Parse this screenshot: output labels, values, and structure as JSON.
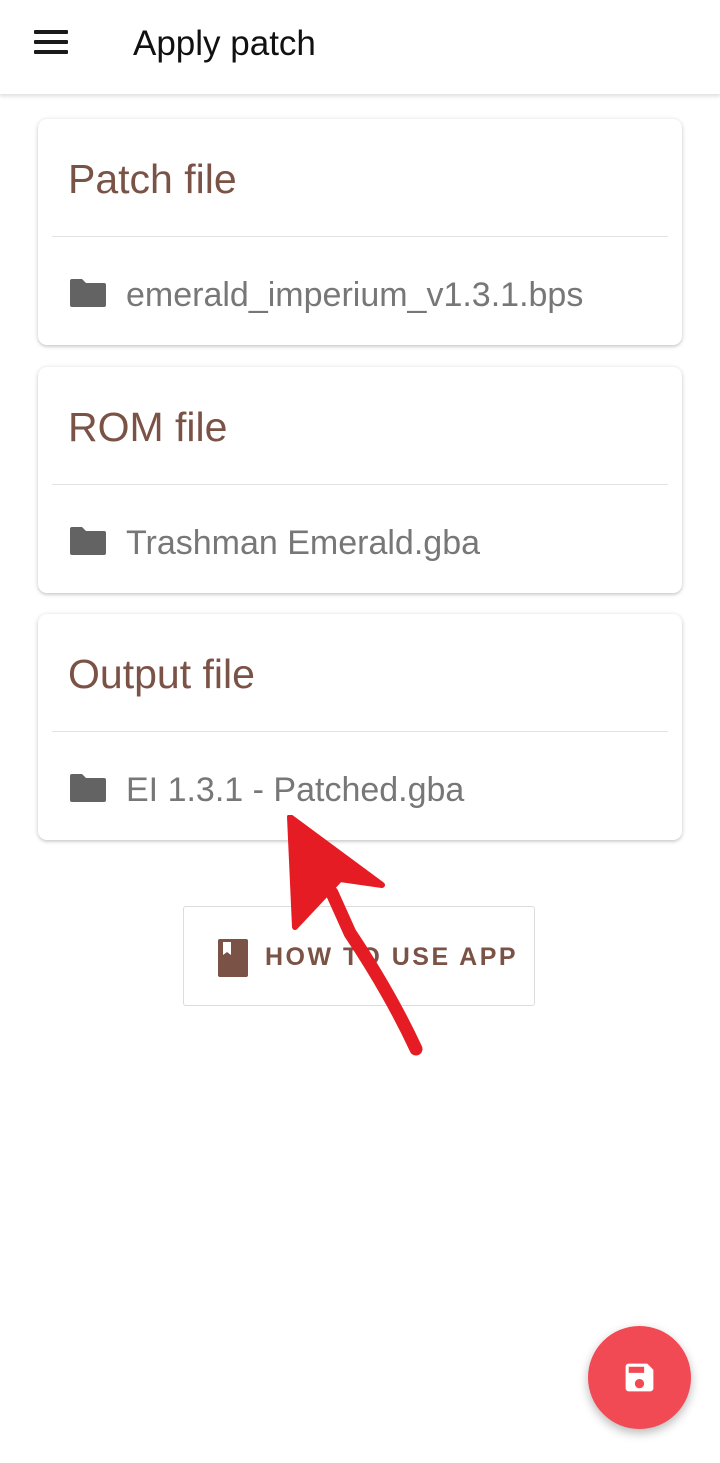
{
  "app_bar": {
    "title": "Apply patch"
  },
  "cards": {
    "patch": {
      "title": "Patch file",
      "file": "emerald_imperium_v1.3.1.bps"
    },
    "rom": {
      "title": "ROM file",
      "file": "Trashman Emerald.gba"
    },
    "output": {
      "title": "Output file",
      "file": "EI 1.3.1 - Patched.gba"
    }
  },
  "help_button": {
    "label": "HOW TO USE APP",
    "icon": "book-icon"
  },
  "fab": {
    "icon": "save-icon",
    "color": "#f24a54"
  },
  "colors": {
    "accent_text": "#7a5246",
    "annotation_arrow": "#e51c23"
  }
}
